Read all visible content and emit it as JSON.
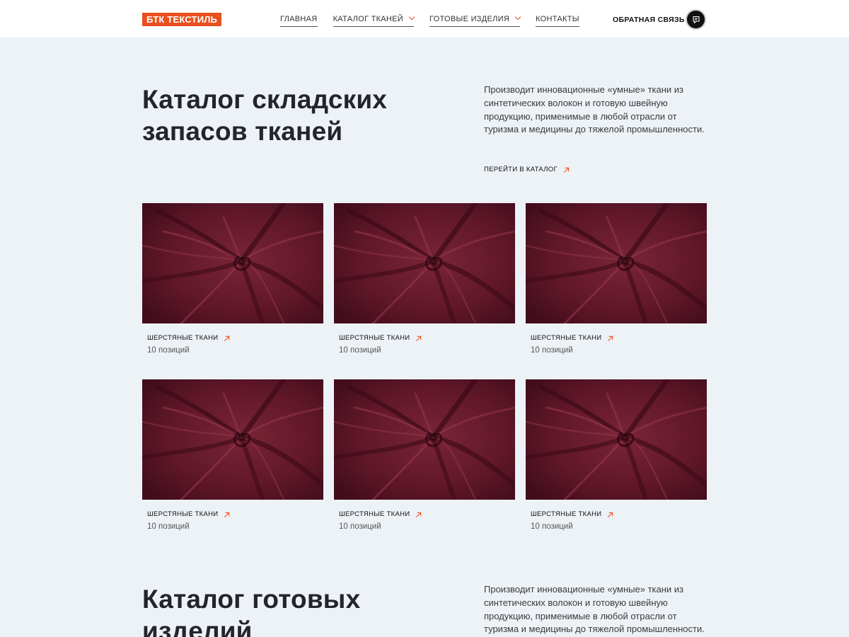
{
  "brand": {
    "logo": "БТК ТЕКСТИЛЬ",
    "accent": "#e8501f"
  },
  "nav": [
    {
      "label": "ГЛАВНАЯ",
      "dropdown": false
    },
    {
      "label": "КАТАЛОГ ТКАНЕЙ",
      "dropdown": true
    },
    {
      "label": "ГОТОВЫЕ ИЗДЕЛИЯ",
      "dropdown": true
    },
    {
      "label": "КОНТАКТЫ",
      "dropdown": false
    }
  ],
  "header": {
    "feedback": "ОБРАТНАЯ СВЯЗЬ",
    "chat_icon": "chat-icon"
  },
  "section1": {
    "title": "Каталог складских запасов тканей",
    "description": "Производит инновационные «умные» ткани из синтетических волокон и готовую швейную продукцию, применимые в любой отрасли от туризма и медицины до тяжелой промышленности.",
    "link": "ПЕРЕЙТИ В КАТАЛОГ"
  },
  "cards": [
    {
      "label": "ШЕРСТЯНЫЕ ТКАНИ",
      "count": "10 позиций"
    },
    {
      "label": "ШЕРСТЯНЫЕ ТКАНИ",
      "count": "10 позиций"
    },
    {
      "label": "ШЕРСТЯНЫЕ ТКАНИ",
      "count": "10 позиций"
    },
    {
      "label": "ШЕРСТЯНЫЕ ТКАНИ",
      "count": "10 позиций"
    },
    {
      "label": "ШЕРСТЯНЫЕ ТКАНИ",
      "count": "10 позиций"
    },
    {
      "label": "ШЕРСТЯНЫЕ ТКАНИ",
      "count": "10 позиций"
    }
  ],
  "section2": {
    "title": "Каталог готовых изделий",
    "description": "Производит инновационные «умные» ткани из синтетических волокон и готовую швейную продукцию, применимые в любой отрасли от туризма и медицины до тяжелой промышленности."
  }
}
